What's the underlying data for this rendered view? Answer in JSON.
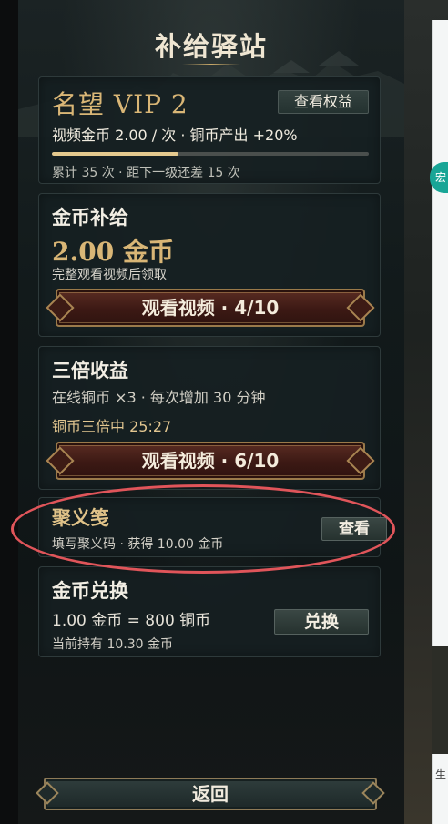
{
  "header": {
    "title": "补给驿站"
  },
  "vip": {
    "title": "名望 VIP 2",
    "rights_button": "查看权益",
    "reward_line": "视频金币 2.00 / 次 · 铜币产出 +20%",
    "progress": 0.4,
    "stats": "累计 35 次 · 距下一级还差 15 次"
  },
  "coin_supply": {
    "heading": "金币补给",
    "amount": "2.00 金币",
    "description": "完整观看视频后领取",
    "button": "观看视频 · 4/10"
  },
  "triple": {
    "heading": "三倍收益",
    "description": "在线铜币 ×3 · 每次增加 30 分钟",
    "status": "铜币三倍中 25:27",
    "button": "观看视频 · 6/10"
  },
  "juyi": {
    "title": "聚义笺",
    "description": "填写聚义码 · 获得 10.00 金币",
    "button": "查看"
  },
  "exchange": {
    "heading": "金币兑换",
    "rate": "1.00 金币 = 800 铜币",
    "holding": "当前持有 10.30 金币",
    "button": "兑换"
  },
  "footer": {
    "back_button": "返回"
  },
  "side_window": {
    "badge_char": "宏",
    "lower_char": "生"
  },
  "colors": {
    "gold": "#d9b676",
    "annotation": "#e0555a",
    "button_red": "#3c1914",
    "teal": "#18a596"
  }
}
